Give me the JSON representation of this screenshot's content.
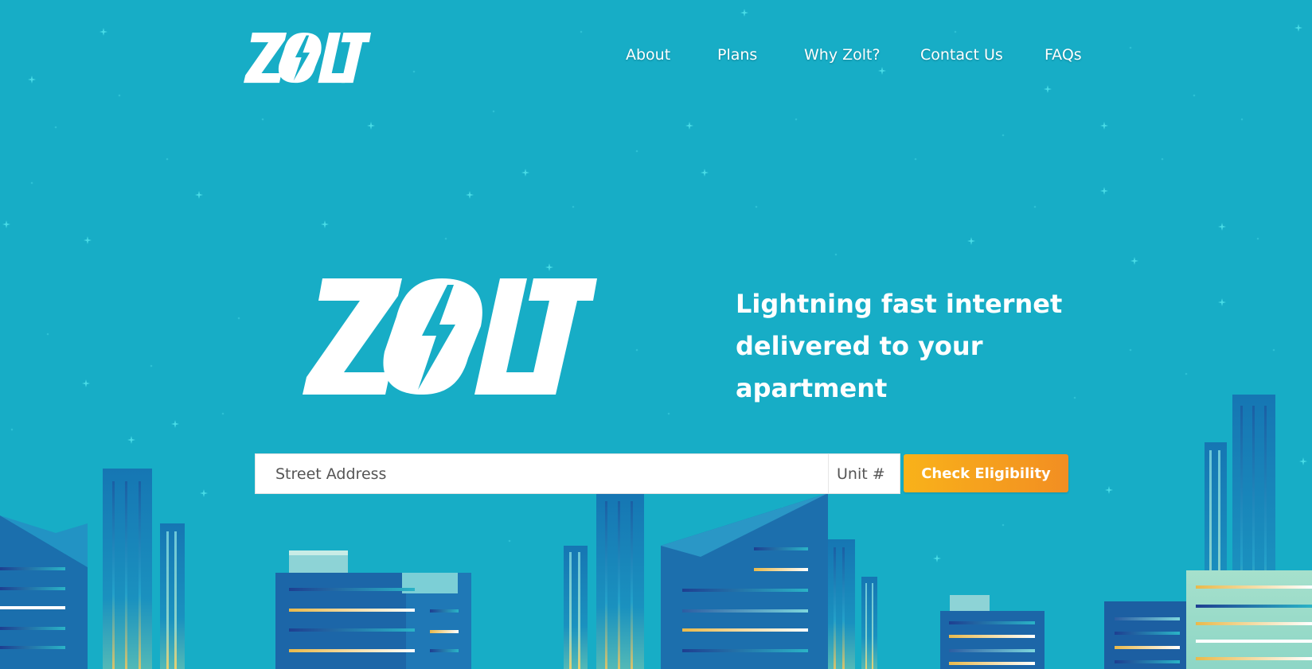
{
  "brand": {
    "name": "ZOLT",
    "logo_color": "#ffffff",
    "background_color": "#17adc6"
  },
  "nav": {
    "items": [
      {
        "label": "About"
      },
      {
        "label": "Plans"
      },
      {
        "label": "Why Zolt?"
      },
      {
        "label": "Contact Us"
      },
      {
        "label": "FAQs"
      }
    ]
  },
  "hero": {
    "tagline": "Lightning fast internet delivered to your apartment"
  },
  "search": {
    "street_placeholder": "Street Address",
    "unit_placeholder": "Unit #",
    "button_label": "Check Eligibility",
    "button_color": "#f7a41d"
  }
}
